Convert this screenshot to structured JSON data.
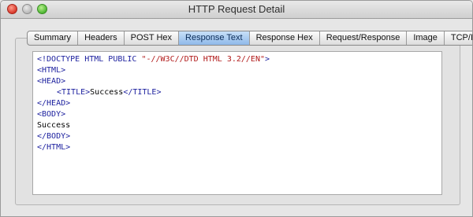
{
  "window": {
    "title": "HTTP Request Detail"
  },
  "tabs": [
    {
      "label": "Summary",
      "active": false
    },
    {
      "label": "Headers",
      "active": false
    },
    {
      "label": "POST Hex",
      "active": false
    },
    {
      "label": "Response Text",
      "active": true
    },
    {
      "label": "Response Hex",
      "active": false
    },
    {
      "label": "Request/Response",
      "active": false
    },
    {
      "label": "Image",
      "active": false
    },
    {
      "label": "TCP/IP",
      "active": false
    }
  ],
  "response": {
    "doctype_start": "<!DOCTYPE HTML PUBLIC ",
    "doctype_string": "\"-//W3C//DTD HTML 3.2//EN\"",
    "doctype_end": ">",
    "html_open": "<HTML>",
    "head_open": "<HEAD>",
    "title_open": "<TITLE>",
    "title_text": "Success",
    "title_close": "</TITLE>",
    "head_close": "</HEAD>",
    "body_open": "<BODY>",
    "body_text": "Success",
    "body_close": "</BODY>",
    "html_close": "</HTML>"
  },
  "colors": {
    "tag": "#1b1f9e",
    "string": "#b11a1a",
    "active_tab": "#8fb9ea"
  }
}
